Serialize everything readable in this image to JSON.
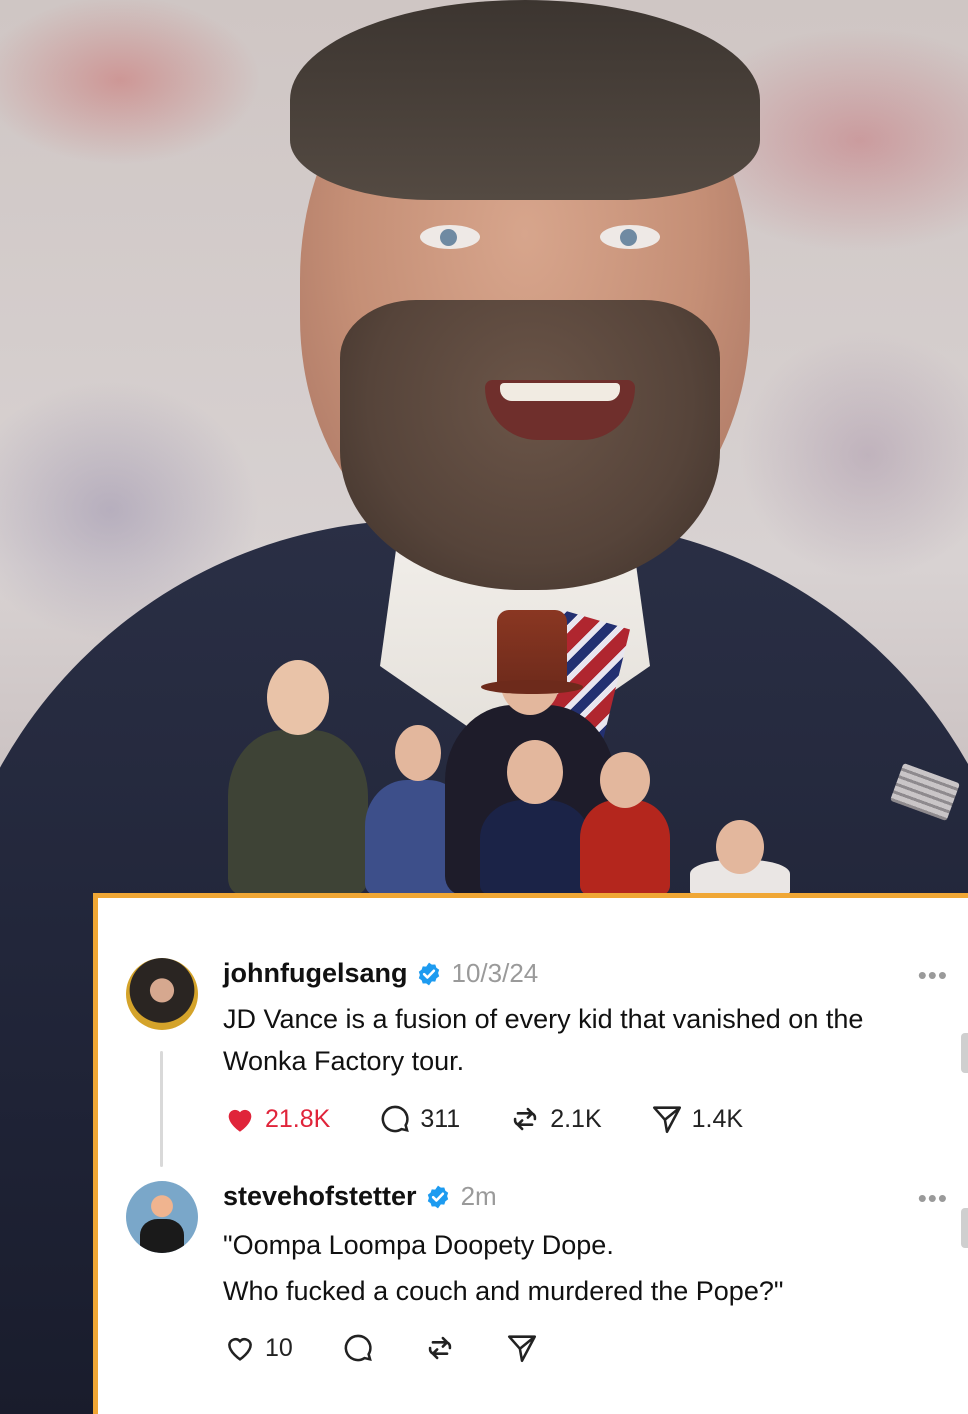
{
  "posts": [
    {
      "username": "johnfugelsang",
      "time": "10/3/24",
      "text_line1": "JD Vance is a fusion of every kid that vanished on the",
      "text_line2": "Wonka Factory tour.",
      "likes": "21.8K",
      "replies": "311",
      "reposts": "2.1K",
      "shares": "1.4K",
      "liked": true,
      "menu": "•••"
    },
    {
      "username": "stevehofstetter",
      "time": "2m",
      "text_line1": "\"Oompa Loompa Doopety Dope.",
      "text_line2": "Who fucked a couch and murdered the Pope?\"",
      "likes": "10",
      "liked": false,
      "menu": "•••"
    }
  ],
  "colors": {
    "card_border": "#f0a735",
    "like_red": "#e0243a",
    "verified_blue": "#1d9bf0"
  }
}
